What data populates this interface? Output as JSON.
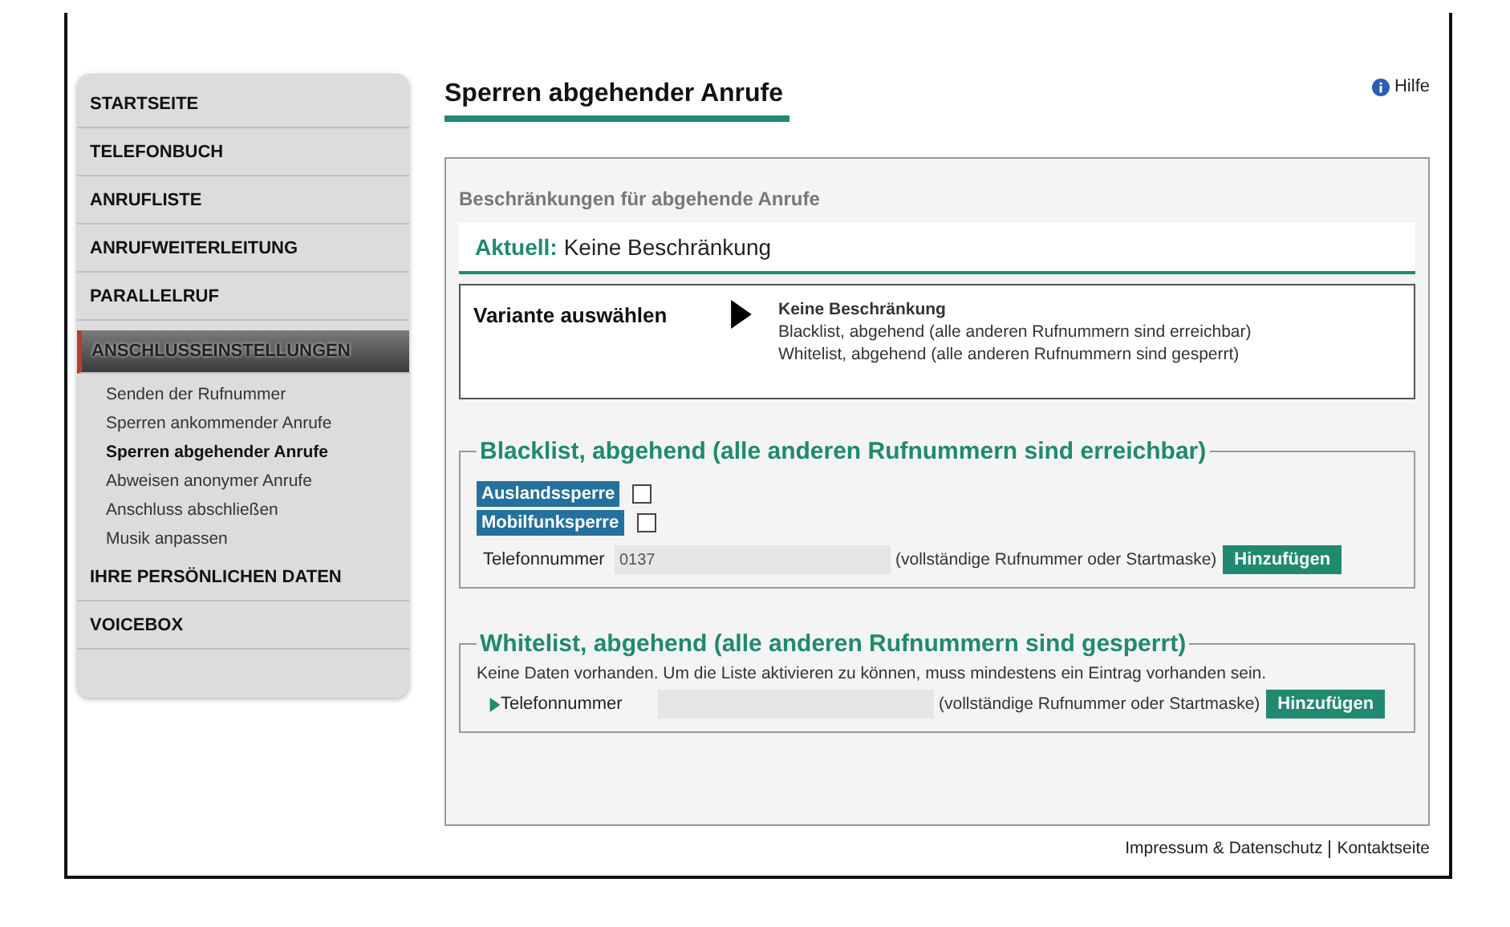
{
  "sidebar": {
    "items": [
      {
        "label": "STARTSEITE",
        "selected": false
      },
      {
        "label": "TELEFONBUCH",
        "selected": false
      },
      {
        "label": "ANRUFLISTE",
        "selected": false
      },
      {
        "label": "ANRUFWEITERLEITUNG",
        "selected": false
      },
      {
        "label": "PARALLELRUF",
        "selected": false
      },
      {
        "label": "ANSCHLUSSEINSTELLUNGEN",
        "selected": true,
        "children": [
          {
            "label": "Senden der Rufnummer",
            "selected": false
          },
          {
            "label": "Sperren ankommender Anrufe",
            "selected": false
          },
          {
            "label": "Sperren abgehender Anrufe",
            "selected": true
          },
          {
            "label": "Abweisen anonymer Anrufe",
            "selected": false
          },
          {
            "label": "Anschluss abschließen",
            "selected": false
          },
          {
            "label": "Musik anpassen",
            "selected": false
          }
        ]
      },
      {
        "label": "IHRE PERSÖNLICHEN DATEN",
        "selected": false
      },
      {
        "label": "VOICEBOX",
        "selected": false
      }
    ]
  },
  "page_title": "Sperren abgehender Anrufe",
  "help_link": "Hilfe",
  "section_heading": "Beschränkungen für abgehende Anrufe",
  "current": {
    "label": "Aktuell:",
    "value": "Keine Beschränkung"
  },
  "variant": {
    "label": "Variante auswählen",
    "options": [
      {
        "label": "Keine Beschränkung",
        "selected": true
      },
      {
        "label": "Blacklist, abgehend (alle anderen Rufnummern sind erreichbar)",
        "selected": false
      },
      {
        "label": "Whitelist, abgehend (alle anderen Rufnummern sind gesperrt)",
        "selected": false
      }
    ]
  },
  "blacklist": {
    "title": "Blacklist, abgehend (alle anderen Rufnummern sind erreichbar)",
    "checkboxes": [
      {
        "label": "Auslandssperre",
        "checked": false
      },
      {
        "label": "Mobilfunksperre",
        "checked": false
      }
    ],
    "phone_label": "Telefonnummer",
    "phone_value": "0137",
    "hint": "(vollständige Rufnummer oder Startmaske)",
    "button": "Hinzufügen"
  },
  "whitelist": {
    "title": "Whitelist, abgehend (alle anderen Rufnummern sind gesperrt)",
    "message": "Keine Daten vorhanden. Um die Liste aktivieren zu können, muss mindestens ein Eintrag vorhanden sein.",
    "phone_label": "Telefonnummer",
    "hint": "(vollständige Rufnummer oder Startmaske)",
    "button": "Hinzufügen"
  },
  "footer": {
    "links": [
      "Impressum & Datenschutz",
      "Kontaktseite"
    ]
  }
}
